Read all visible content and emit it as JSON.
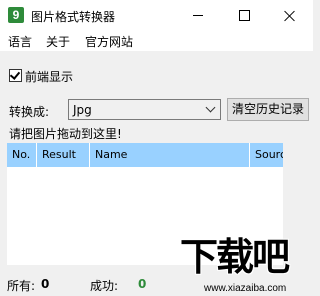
{
  "window": {
    "title": "图片格式转换器",
    "icon_glyph": "9",
    "controls": {
      "minimize": "minimize-icon",
      "maximize": "maximize-icon",
      "close": "close-icon"
    }
  },
  "menu": {
    "items": [
      "语言",
      "关于",
      "官方网站"
    ]
  },
  "options": {
    "topmost_label": "前端显示",
    "topmost_checked": true
  },
  "convert": {
    "label": "转换成:",
    "selected": "Jpg",
    "clear_button": "清空历史记录"
  },
  "drop_hint": "请把图片拖动到这里!",
  "table": {
    "columns": [
      "No.",
      "Result",
      "Name",
      "Sourc"
    ],
    "rows": []
  },
  "status": {
    "total_label": "所有:",
    "total_value": "0",
    "success_label": "成功:",
    "success_value": "0"
  },
  "watermark": {
    "text": "下载吧",
    "url": "www.xiazaiba.com"
  },
  "colors": {
    "header_bg": "#99d1ff",
    "success_green": "#2e8b3a",
    "app_icon": "#2e8b3a"
  }
}
